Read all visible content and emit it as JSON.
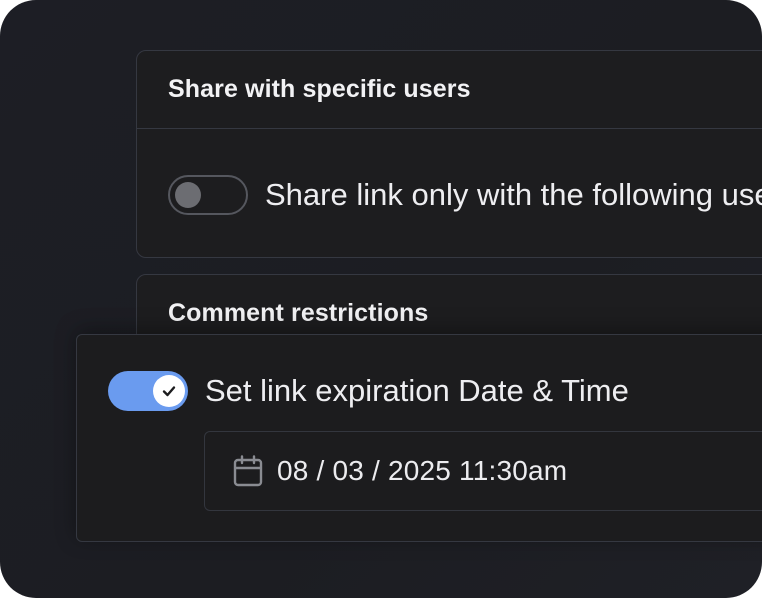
{
  "share_section": {
    "title": "Share with specific users",
    "toggle_label": "Share link only with the following users",
    "toggle_on": false
  },
  "comment_section": {
    "title": "Comment restrictions"
  },
  "expiry_section": {
    "toggle_label": "Set link expiration Date & Time",
    "toggle_on": true,
    "date_value": "08 / 03 / 2025 11:30am",
    "date_icon": "calendar-icon"
  },
  "colors": {
    "accent": "#6a9bef",
    "background": "#1d1e25",
    "card": "#1d1d1f",
    "border": "#353841"
  }
}
